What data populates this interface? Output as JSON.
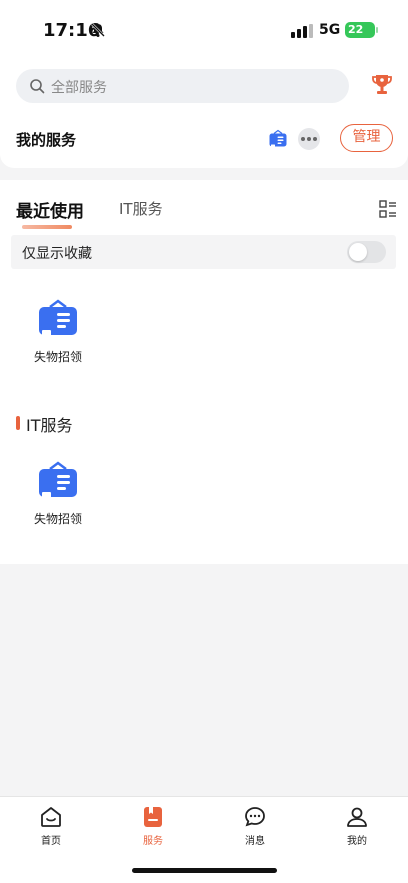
{
  "status": {
    "time": "17:16",
    "network": "5G",
    "battery": "22"
  },
  "search": {
    "placeholder": "全部服务"
  },
  "header": {
    "my_services": "我的服务",
    "manage": "管理"
  },
  "tabs": {
    "recent": "最近使用",
    "it": "IT服务"
  },
  "favorites": {
    "label": "仅显示收藏",
    "enabled": false
  },
  "recent_items": [
    {
      "label": "失物招领",
      "icon": "lost-found-icon"
    }
  ],
  "sections": [
    {
      "title": "IT服务",
      "items": [
        {
          "label": "失物招领",
          "icon": "lost-found-icon"
        }
      ]
    }
  ],
  "nav": [
    {
      "label": "首页",
      "icon": "home-icon",
      "active": false
    },
    {
      "label": "服务",
      "icon": "service-icon",
      "active": true
    },
    {
      "label": "消息",
      "icon": "message-icon",
      "active": false
    },
    {
      "label": "我的",
      "icon": "profile-icon",
      "active": false
    }
  ],
  "colors": {
    "accent": "#e8633e",
    "service_blue": "#3a6ff0",
    "battery_green": "#35c759"
  }
}
